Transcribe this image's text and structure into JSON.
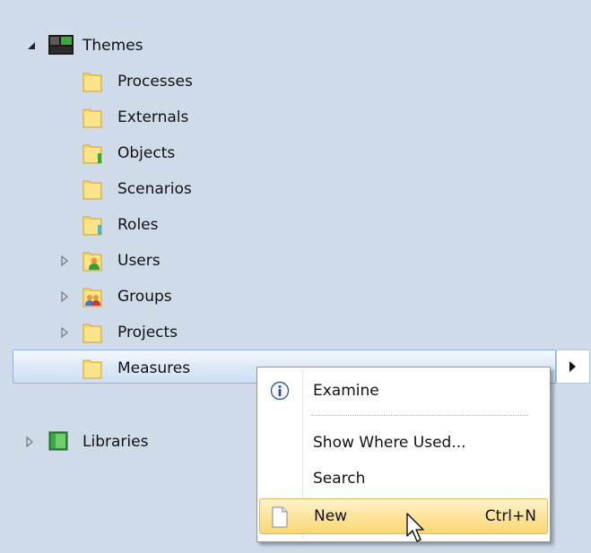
{
  "tree": {
    "themes": {
      "label": "Themes"
    },
    "children": [
      {
        "label": "Processes",
        "type": "folder"
      },
      {
        "label": "Externals",
        "type": "folder"
      },
      {
        "label": "Objects",
        "type": "folder"
      },
      {
        "label": "Scenarios",
        "type": "folder"
      },
      {
        "label": "Roles",
        "type": "folder"
      },
      {
        "label": "Users",
        "type": "folder-user"
      },
      {
        "label": "Groups",
        "type": "folder-group"
      },
      {
        "label": "Projects",
        "type": "folder"
      },
      {
        "label": "Measures",
        "type": "folder"
      }
    ],
    "libraries": {
      "label": "Libraries"
    }
  },
  "context_menu": {
    "examine": {
      "label": "Examine",
      "icon": "info-icon"
    },
    "show_where_used": {
      "label": "Show Where Used..."
    },
    "search": {
      "label": "Search"
    },
    "new": {
      "label": "New",
      "shortcut": "Ctrl+N",
      "icon": "new-document-icon"
    }
  },
  "colors": {
    "background": "#cfdbe9",
    "selection": "#dce8f7",
    "menu_highlight": "#fde49c",
    "folder": "#f7d560"
  }
}
